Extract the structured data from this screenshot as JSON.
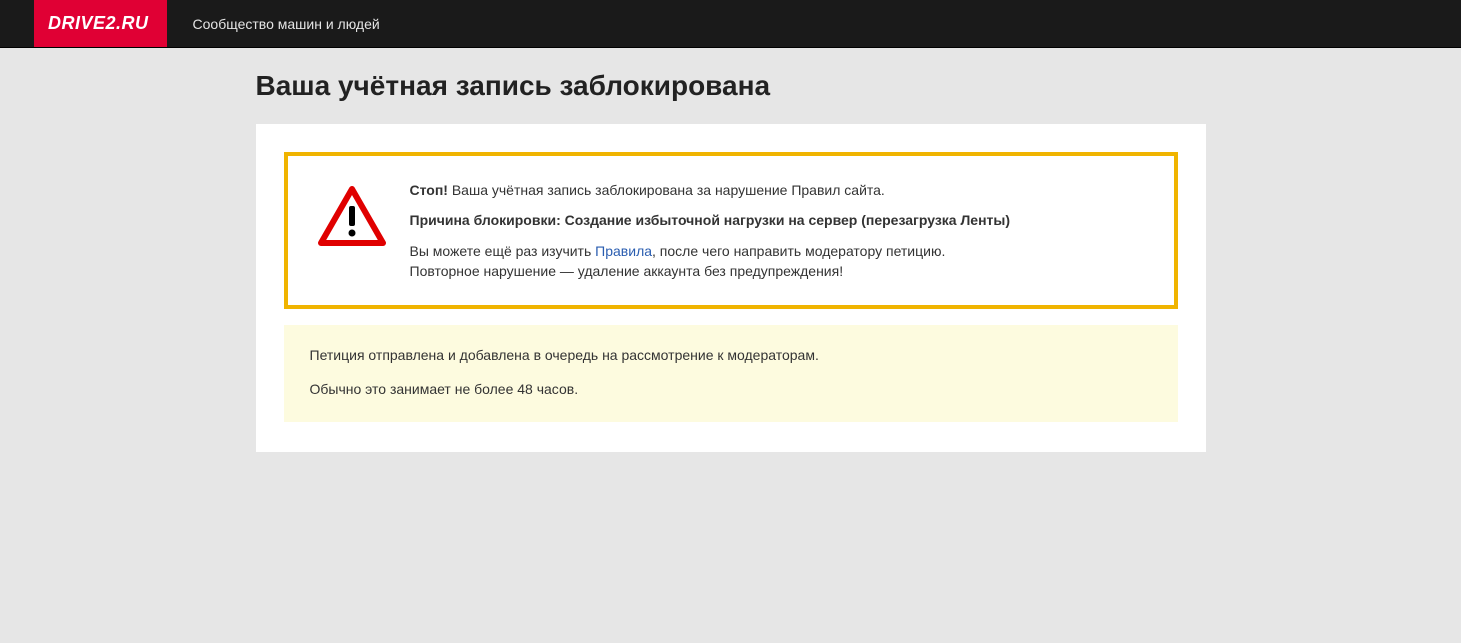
{
  "header": {
    "logo": "DRIVE2.RU",
    "tagline": "Сообщество машин и людей"
  },
  "page": {
    "title": "Ваша учётная запись заблокирована"
  },
  "alert": {
    "stop_label": "Стоп!",
    "stop_text": " Ваша учётная запись заблокирована за нарушение Правил сайта.",
    "reason_label": "Причина блокировки: Создание избыточной нагрузки на сервер (перезагрузка Ленты)",
    "rules_pre": "Вы можете ещё раз изучить ",
    "rules_link": "Правила",
    "rules_post": ", после чего направить модератору петицию.",
    "warning_line": "Повторное нарушение — удаление аккаунта без предупреждения!"
  },
  "info": {
    "line1": "Петиция отправлена и добавлена в очередь на рассмотрение к модераторам.",
    "line2": "Обычно это занимает не более 48 часов."
  }
}
